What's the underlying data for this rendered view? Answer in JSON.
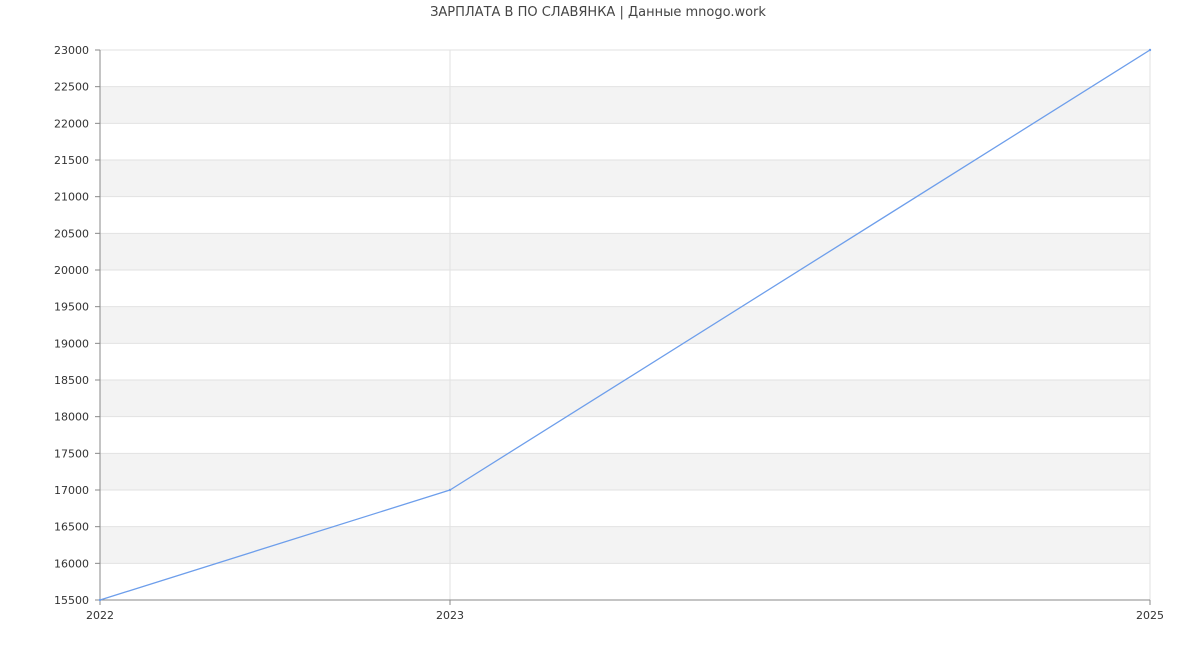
{
  "chart_data": {
    "type": "line",
    "title": "ЗАРПЛАТА В ПО СЛАВЯНКА | Данные mnogo.work",
    "xlabel": "",
    "ylabel": "",
    "x": [
      2022,
      2023,
      2025
    ],
    "xlim": [
      2022,
      2025
    ],
    "xticks": [
      2022,
      2023,
      2025
    ],
    "ylim": [
      15500,
      23000
    ],
    "yticks": [
      15500,
      16000,
      16500,
      17000,
      17500,
      18000,
      18500,
      19000,
      19500,
      20000,
      20500,
      21000,
      21500,
      22000,
      22500,
      23000
    ],
    "series": [
      {
        "values": [
          15500,
          17000,
          23000
        ],
        "color": "#6d9eeb"
      }
    ],
    "grid": true,
    "band_color": "#f3f3f3",
    "grid_color": "#e2e2e2",
    "axis_color": "#888888",
    "legend": "none"
  }
}
